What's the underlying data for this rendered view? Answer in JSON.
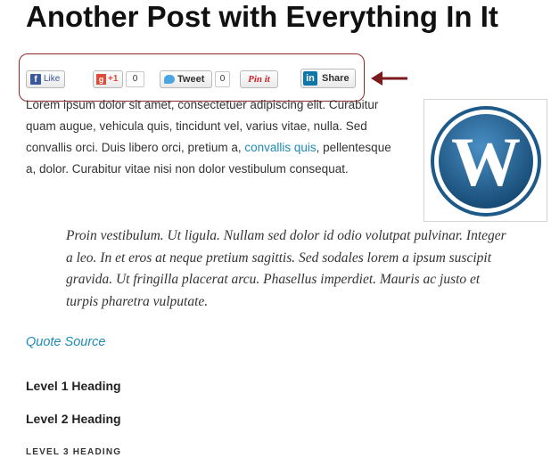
{
  "post": {
    "title": "Another Post with Everything In It"
  },
  "share_bar": {
    "facebook": {
      "icon": "facebook-icon",
      "label": "Like"
    },
    "google_plus": {
      "icon": "google-plus-icon",
      "label": "+1",
      "count": "0"
    },
    "twitter": {
      "icon": "twitter-bird-icon",
      "label": "Tweet",
      "count": "0"
    },
    "pinterest": {
      "label": "Pin it"
    },
    "linkedin": {
      "icon": "linkedin-icon",
      "label": "Share"
    },
    "highlight_color": "#8b2a2a"
  },
  "content": {
    "paragraph_before_link": "Lorem ipsum dolor sit amet, consectetuer adipiscing elit. Curabitur quam augue, vehicula quis, tincidunt vel, varius vitae, nulla. Sed convallis orci. Duis libero orci, pretium a, ",
    "paragraph_link": "convallis quis",
    "paragraph_after_link": ", pellentesque a, dolor. Curabitur vitae nisi non dolor vestibulum consequat.",
    "image_icon": "wordpress-logo-icon",
    "blockquote": "Proin vestibulum. Ut ligula. Nullam sed dolor id odio volutpat pulvinar. Integer a leo. In et eros at neque pretium sagittis. Sed sodales lorem a ipsum suscipit gravida. Ut fringilla placerat arcu. Phasellus imperdiet. Mauris ac justo et turpis pharetra vulputate.",
    "quote_source": "Quote Source",
    "heading_level_1": "Level 1 Heading",
    "heading_level_2": "Level 2 Heading",
    "heading_level_3": "Level 3 Heading",
    "link_color": "#1e8bb7"
  }
}
